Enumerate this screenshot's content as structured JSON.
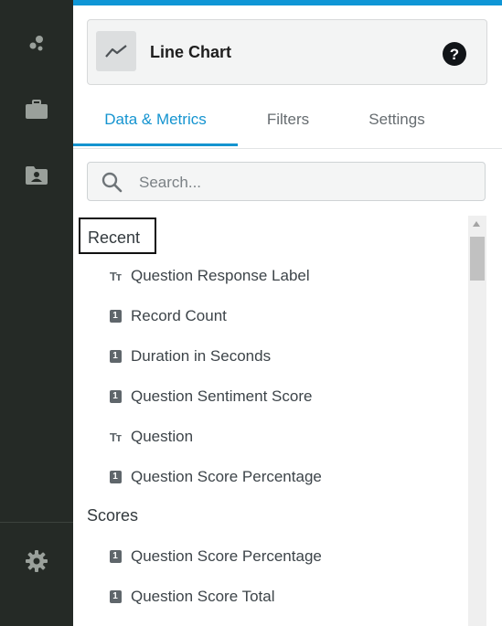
{
  "rail": {
    "icons": [
      "bubbles-icon",
      "briefcase-icon",
      "folder-user-icon",
      "gear-icon"
    ]
  },
  "viz": {
    "title": "Line Chart",
    "icon": "line-chart-icon",
    "help_icon": "question-circle-icon"
  },
  "tabs": [
    {
      "label": "Data & Metrics",
      "active": true
    },
    {
      "label": "Filters",
      "active": false
    },
    {
      "label": "Settings",
      "active": false
    }
  ],
  "search": {
    "placeholder": "Search...",
    "value": ""
  },
  "sections": [
    {
      "title": "Recent",
      "items": [
        {
          "type": "text",
          "label": "Question Response Label"
        },
        {
          "type": "number",
          "label": "Record Count"
        },
        {
          "type": "number",
          "label": "Duration in Seconds"
        },
        {
          "type": "number",
          "label": "Question Sentiment Score"
        },
        {
          "type": "text",
          "label": "Question"
        },
        {
          "type": "number",
          "label": "Question Score Percentage"
        }
      ]
    },
    {
      "title": "Scores",
      "items": [
        {
          "type": "number",
          "label": "Question Score Percentage"
        },
        {
          "type": "number",
          "label": "Question Score Total"
        }
      ]
    }
  ],
  "icon_glyphs": {
    "text": "Tт",
    "number": "1"
  },
  "colors": {
    "accent": "#1594d0",
    "rail": "#252a26",
    "top_bar": "#0f96d6"
  }
}
